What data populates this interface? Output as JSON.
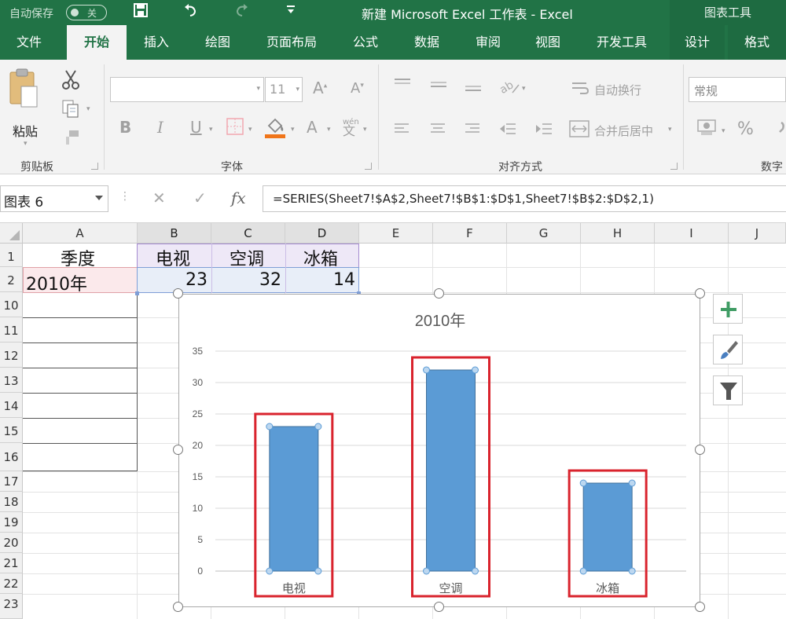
{
  "titlebar": {
    "autosave_label": "自动保存",
    "autosave_state": "关",
    "title": "新建 Microsoft Excel 工作表  -  Excel",
    "context_group": "图表工具"
  },
  "tabs": [
    {
      "label": "文件"
    },
    {
      "label": "开始"
    },
    {
      "label": "插入"
    },
    {
      "label": "绘图"
    },
    {
      "label": "页面布局"
    },
    {
      "label": "公式"
    },
    {
      "label": "数据"
    },
    {
      "label": "审阅"
    },
    {
      "label": "视图"
    },
    {
      "label": "开发工具"
    },
    {
      "label": "设计"
    },
    {
      "label": "格式"
    }
  ],
  "ribbon": {
    "clipboard": {
      "paste_label": "粘贴",
      "group_label": "剪贴板"
    },
    "font": {
      "font_name": "",
      "font_size": "11",
      "group_label": "字体",
      "bold": "B",
      "italic": "I",
      "underline": "U",
      "grow": "A",
      "shrink": "A",
      "font_color": "A",
      "phonetic_top": "wén",
      "phonetic_bottom": "文"
    },
    "alignment": {
      "wrap_label": "自动换行",
      "merge_label": "合并后居中",
      "group_label": "对齐方式"
    },
    "number": {
      "format": "常规",
      "percent": "%",
      "group_label": "数字"
    }
  },
  "formula_bar": {
    "name_box": "图表 6",
    "cancel": "✕",
    "confirm": "✓",
    "fx": "fx",
    "formula": "=SERIES(Sheet7!$A$2,Sheet7!$B$1:$D$1,Sheet7!$B$2:$D$2,1)"
  },
  "grid": {
    "columns": [
      "A",
      "B",
      "C",
      "D",
      "E",
      "F",
      "G",
      "H",
      "I",
      "J"
    ],
    "rows": [
      "1",
      "2",
      "10",
      "11",
      "12",
      "13",
      "14",
      "15",
      "16",
      "17",
      "18",
      "19",
      "20",
      "21",
      "22",
      "23"
    ],
    "cells": {
      "A1": "季度",
      "B1": "电视",
      "C1": "空调",
      "D1": "冰箱",
      "A2": "2010年",
      "B2": "23",
      "C2": "32",
      "D2": "14"
    }
  },
  "chart_data": {
    "type": "bar",
    "title": "2010年",
    "categories": [
      "电视",
      "空调",
      "冰箱"
    ],
    "values": [
      23,
      32,
      14
    ],
    "ylim": [
      0,
      35
    ],
    "yticks": [
      0,
      5,
      10,
      15,
      20,
      25,
      30,
      35
    ],
    "grid": true,
    "legend": "none",
    "bar_color": "#5b9bd5",
    "highlight_color": "#d9232d"
  },
  "colors": {
    "excel_green": "#217346",
    "ribbon_bg": "#f3f3f3",
    "series_fill": "#5b9bd5",
    "header_fill": "#eee8f7",
    "label_fill": "#fbe9eb"
  }
}
